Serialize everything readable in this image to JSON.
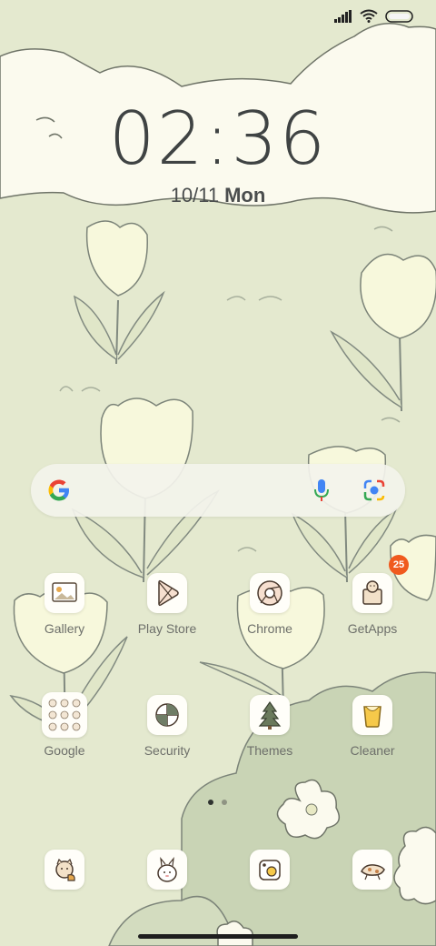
{
  "lockscreen": {
    "time": "02:36",
    "date": "10/11",
    "weekday": "Mon"
  },
  "status": {
    "signal_icon": "signal-icon",
    "wifi_icon": "wifi-icon",
    "battery_icon": "battery-icon"
  },
  "search": {
    "google_icon": "google-g-icon",
    "mic_icon": "mic-icon",
    "lens_icon": "lens-icon"
  },
  "apps": [
    {
      "label": "Gallery",
      "icon": "gallery-icon"
    },
    {
      "label": "Play Store",
      "icon": "play-store-icon"
    },
    {
      "label": "Chrome",
      "icon": "chrome-icon"
    },
    {
      "label": "GetApps",
      "icon": "getapps-icon",
      "badge": "25"
    },
    {
      "label": "Google",
      "icon": "google-folder-icon"
    },
    {
      "label": "Security",
      "icon": "security-icon"
    },
    {
      "label": "Themes",
      "icon": "themes-icon"
    },
    {
      "label": "Cleaner",
      "icon": "cleaner-icon"
    }
  ],
  "dock": [
    {
      "icon": "phone-icon"
    },
    {
      "icon": "messages-icon"
    },
    {
      "icon": "camera-icon"
    },
    {
      "icon": "browser-icon"
    }
  ],
  "pager": {
    "pages": 2,
    "current": 1
  },
  "colors": {
    "background": "#e4e9cf",
    "clock": "#3f4343",
    "badge": "#f05a1e"
  }
}
